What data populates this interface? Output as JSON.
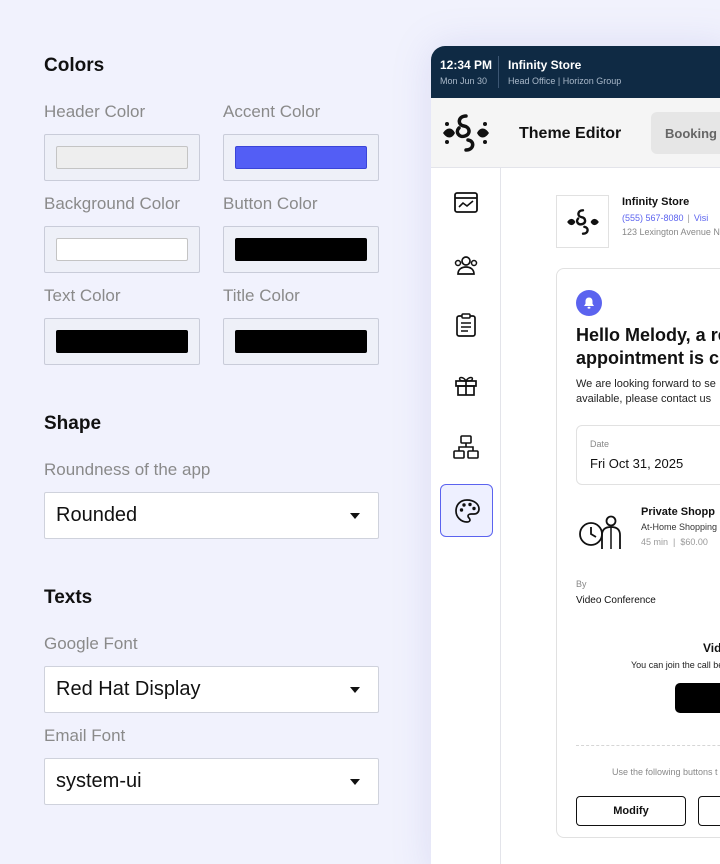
{
  "colors": {
    "section_title": "Colors",
    "header_color": {
      "label": "Header Color",
      "value": "#eeeeee"
    },
    "accent_color": {
      "label": "Accent Color",
      "value": "#535ef5"
    },
    "background_color": {
      "label": "Background Color",
      "value": "#ffffff"
    },
    "button_color": {
      "label": "Button Color",
      "value": "#000000"
    },
    "text_color": {
      "label": "Text Color",
      "value": "#000000"
    },
    "title_color": {
      "label": "Title Color",
      "value": "#000000"
    }
  },
  "shape": {
    "section_title": "Shape",
    "roundness_label": "Roundness of the app",
    "roundness_value": "Rounded"
  },
  "texts": {
    "section_title": "Texts",
    "google_font_label": "Google Font",
    "google_font_value": "Red Hat Display",
    "email_font_label": "Email Font",
    "email_font_value": "system-ui"
  },
  "preview": {
    "topbar": {
      "time": "12:34 PM",
      "date": "Mon Jun 30",
      "store": "Infinity Store",
      "office": "Head Office | Horizon Group"
    },
    "header": {
      "title": "Theme Editor",
      "tab": "Booking V"
    },
    "sidebar_icons": [
      "dashboard-icon",
      "customers-icon",
      "clipboard-icon",
      "gift-icon",
      "organization-icon",
      "palette-icon"
    ],
    "store": {
      "name": "Infinity Store",
      "phone": "(555) 567-8080",
      "link": "Visi",
      "address": "123 Lexington Avenue N"
    },
    "email": {
      "greeting_line1": "Hello Melody, a re",
      "greeting_line2": "appointment is c",
      "intro_line1": "We are looking forward to se",
      "intro_line2": "available, please contact us",
      "date_label": "Date",
      "date_value": "Fri Oct 31, 2025",
      "service_name": "Private Shopp",
      "service_sub": "At-Home Shopping",
      "service_duration": "45 min",
      "service_price": "$60.00",
      "by_label": "By",
      "by_value": "Video Conference",
      "vc_title": "Vid",
      "vc_sub": "You can join the call be",
      "use_buttons_text": "Use the following buttons t",
      "modify_button": "Modify"
    },
    "accent": "#5b63ef",
    "topbar_bg": "#0f2a44"
  }
}
